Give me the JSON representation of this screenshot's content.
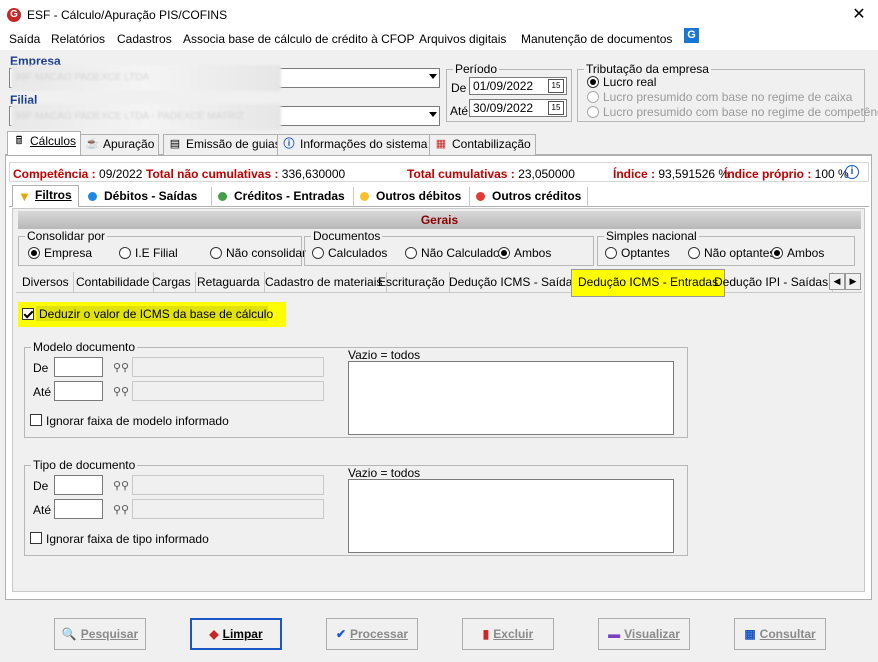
{
  "window": {
    "title": "ESF - Cálculo/Apuração PIS/COFINS",
    "close_label": "✕"
  },
  "menu": [
    "Saída",
    "Relatórios",
    "Cadastros",
    "Associa base de cálculo de crédito à CFOP",
    "Arquivos digitais",
    "Manutenção de documentos"
  ],
  "empresa": {
    "label": "Empresa",
    "value": "99F MACAO PADEXCE LTDA"
  },
  "filial": {
    "label": "Filial",
    "value": "99F MACAO PADEXCE LTDA - PADEXCE MATRIZ"
  },
  "periodo": {
    "legend": "Período",
    "de_label": "De",
    "de_value": "01/09/2022",
    "ate_label": "Até",
    "ate_value": "30/09/2022"
  },
  "tributacao": {
    "legend": "Tributação da empresa",
    "options": [
      "Lucro real",
      "Lucro presumido com base no regime de caixa",
      "Lucro presumido com base no regime de competência"
    ],
    "selected": "Lucro real"
  },
  "main_tabs": [
    "Cálculos",
    "Apuração",
    "Emissão de guias",
    "Informações do sistema",
    "Contabilização"
  ],
  "status": {
    "competencia_label": "Competência :",
    "competencia_value": " 09/2022",
    "nao_cum_label": "Total não cumulativas :",
    "nao_cum_value": " 336,630000",
    "cum_label": "Total cumulativas :",
    "cum_value": " 23,050000",
    "indice_label": "Índice :",
    "indice_value": " 93,591526 %",
    "indice_proprio_label": "Índice próprio :",
    "indice_proprio_value": " 100 %"
  },
  "sub_tabs": [
    "Filtros",
    "Débitos - Saídas",
    "Créditos - Entradas",
    "Outros débitos",
    "Outros créditos"
  ],
  "gerais": {
    "title": "Gerais",
    "consolidar": {
      "legend": "Consolidar por",
      "options": [
        "Empresa",
        "I.E Filial",
        "Não consolidar"
      ],
      "selected": "Empresa"
    },
    "documentos": {
      "legend": "Documentos",
      "options": [
        "Calculados",
        "Não Calculados",
        "Ambos"
      ],
      "selected": "Ambos"
    },
    "simples": {
      "legend": "Simples nacional",
      "options": [
        "Optantes",
        "Não optantes",
        "Ambos"
      ],
      "selected": "Ambos"
    }
  },
  "detail_tabs": [
    "Diversos",
    "Contabilidade",
    "Cargas",
    "Retaguarda",
    "Cadastro de materiais",
    "Escrituração",
    "Dedução ICMS - Saídas",
    "Dedução ICMS - Entradas",
    "Dedução IPI - Saídas"
  ],
  "deduzir": {
    "label": "Deduzir o valor de ICMS da base de cálculo",
    "checked": true
  },
  "modelo": {
    "legend": "Modelo documento",
    "de": "De",
    "ate": "Até",
    "vazio": "Vazio = todos",
    "ignorar": "Ignorar faixa de modelo informado"
  },
  "tipo": {
    "legend": "Tipo de documento",
    "de": "De",
    "ate": "Até",
    "vazio": "Vazio = todos",
    "ignorar": "Ignorar faixa de tipo informado"
  },
  "buttons": [
    "Pesquisar",
    "Limpar",
    "Processar",
    "Excluir",
    "Visualizar",
    "Consultar"
  ],
  "colors": {
    "accent_red": "#c00000",
    "label_blue": "#1a3e8c",
    "highlight": "#ffff00",
    "active_border": "#1a56c4"
  }
}
